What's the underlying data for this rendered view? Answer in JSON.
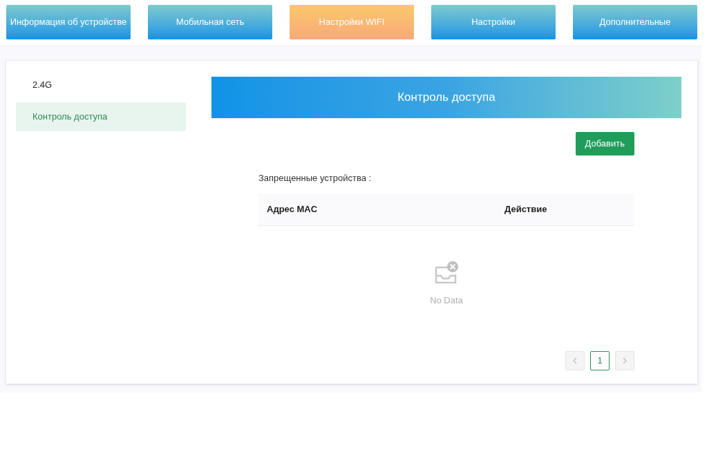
{
  "tabs": [
    {
      "label": "Информация об устройстве",
      "selected": false
    },
    {
      "label": "Мобильная сеть",
      "selected": false
    },
    {
      "label": "Настройки WIFI",
      "selected": true
    },
    {
      "label": "Настройки",
      "selected": false
    },
    {
      "label": "Дополнительные",
      "selected": false
    }
  ],
  "sidebar": {
    "items": [
      {
        "label": "2.4G",
        "selected": false
      },
      {
        "label": "Контроль доступа",
        "selected": true
      }
    ]
  },
  "panel": {
    "title": "Контроль доступа",
    "add_button": "Добавить",
    "list_label": "Запрещенные устройства :",
    "table": {
      "columns": [
        "Адрес MAC",
        "Действие"
      ],
      "empty_text": "No Data"
    },
    "pagination": {
      "prev_disabled": true,
      "next_disabled": true,
      "pages": [
        {
          "label": "1",
          "selected": true
        }
      ]
    }
  }
}
